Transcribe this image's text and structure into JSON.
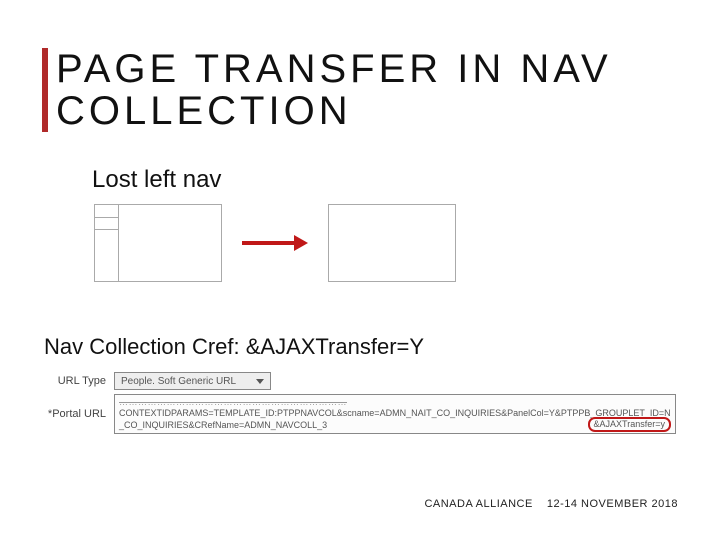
{
  "title": "PAGE TRANSFER IN NAV COLLECTION",
  "subheading": "Lost left nav",
  "cref_line": "Nav Collection Cref: &AJAXTransfer=Y",
  "form": {
    "url_type_label": "URL Type",
    "url_type_value": "People. Soft Generic URL",
    "portal_url_label": "Portal URL",
    "url_line1": "………………………………………………………………",
    "url_line2": "CONTEXTIDPARAMS=TEMPLATE_ID:PTPPNAVCOL&scname=ADMN_NAIT_CO_INQUIRIES&PanelCol=Y&PTPPB_GROUPLET_ID=N_CO_INQUIRIES&CRefName=ADMN_NAVCOLL_3",
    "highlight": "&AJAXTransfer=y"
  },
  "footer": {
    "org": "CANADA ALLIANCE",
    "date": "12-14 NOVEMBER 2018"
  }
}
